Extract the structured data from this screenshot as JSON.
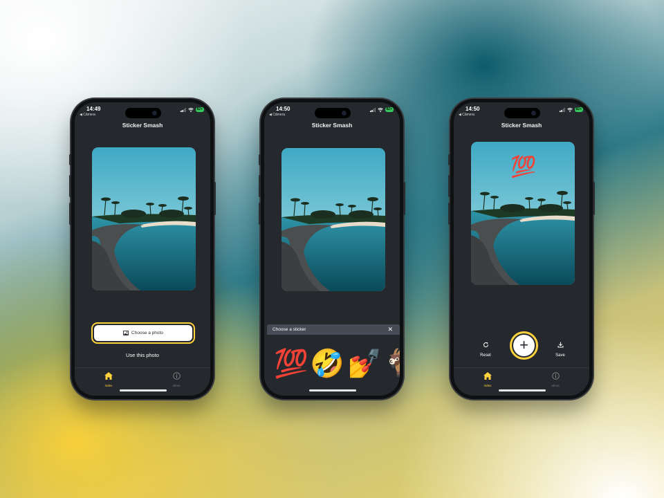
{
  "phones": [
    {
      "status": {
        "time": "14:49",
        "back": "◀ Câmera",
        "battery": "82+"
      },
      "title": "Sticker Smash",
      "primary_button": {
        "label": "Choose a photo",
        "icon": "image-icon"
      },
      "secondary_link": "Use this photo",
      "tabs": [
        {
          "label": "index",
          "icon": "home-icon",
          "active": true
        },
        {
          "label": "about",
          "icon": "info-icon",
          "active": false
        }
      ]
    },
    {
      "status": {
        "time": "14:50",
        "back": "◀ Câmera",
        "battery": "82+"
      },
      "title": "Sticker Smash",
      "sticker_picker": {
        "title": "Choose a sticker",
        "close_icon": "close-icon",
        "stickers": [
          "💯",
          "🤣",
          "💅",
          "🐐"
        ]
      }
    },
    {
      "status": {
        "time": "14:50",
        "back": "◀ Câmera",
        "battery": "82+"
      },
      "title": "Sticker Smash",
      "placed_sticker": "💯",
      "options": {
        "reset": {
          "label": "Reset",
          "icon": "refresh-icon"
        },
        "add": {
          "label": "+",
          "icon": "add-icon"
        },
        "save": {
          "label": "Save",
          "icon": "download-icon"
        }
      },
      "tabs": [
        {
          "label": "index",
          "icon": "home-icon",
          "active": true
        },
        {
          "label": "about",
          "icon": "info-icon",
          "active": false
        }
      ]
    }
  ],
  "colors": {
    "accent": "#ffd33d",
    "screen_bg": "#25292e",
    "sheet_header": "#464c55"
  }
}
